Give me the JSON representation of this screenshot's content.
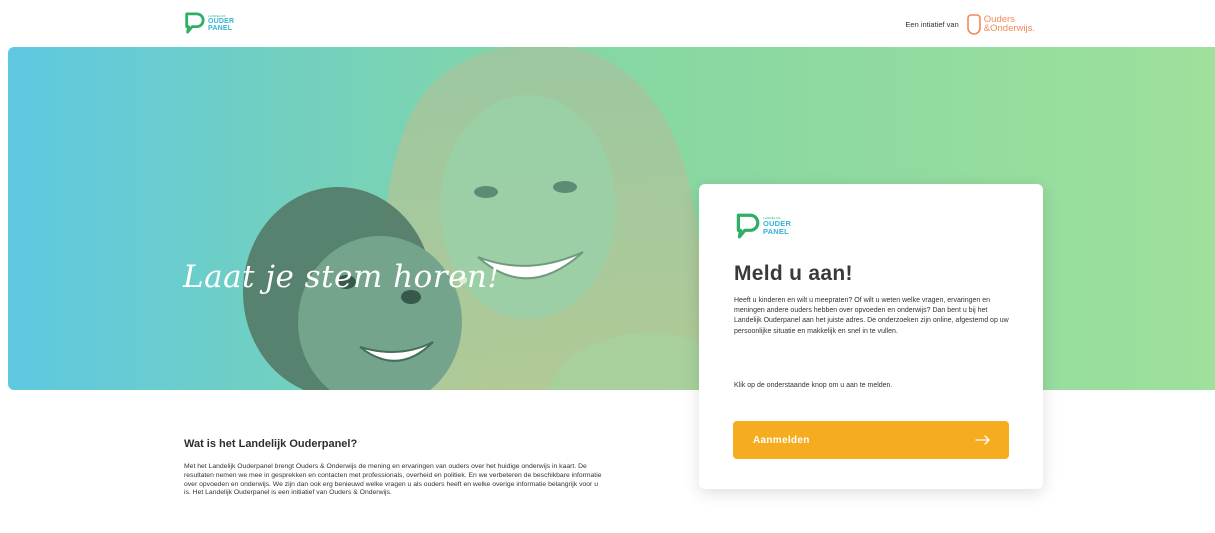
{
  "header": {
    "logo": {
      "small": "LANDELIJK",
      "line1": "OUDER",
      "line2": "PANEL"
    },
    "initiative_label": "Een intiatief van",
    "partner": {
      "line1": "Ouders",
      "line2": "&Onderwijs."
    }
  },
  "hero": {
    "tagline": "Laat je stem horen!"
  },
  "signup": {
    "logo": {
      "small": "LANDELIJK",
      "line1": "OUDER",
      "line2": "PANEL"
    },
    "title": "Meld u aan!",
    "text": "Heeft u kinderen en wilt u meepraten? Of wilt u weten welke vragen, ervaringen en meningen andere ouders hebben over opvoeden en onderwijs? Dan bent u bij het Landelijk Ouderpanel aan het juiste adres. De onderzoeken zijn online, afgestemd op uw persoonlijke situatie en makkelijk en snel in te vullen.",
    "cta_text": "Klik op de onderstaande knop om u aan te melden.",
    "button_label": "Aanmelden",
    "button_icon": "arrow-right-icon"
  },
  "info": {
    "title": "Wat is het Landelijk Ouderpanel?",
    "text": "Met het Landelijk Ouderpanel brengt Ouders & Onderwijs de mening en ervaringen van ouders over het huidige onderwijs in kaart. De resultaten nemen we mee in gesprekken en contacten met professionals, overheid en politiek. En we verbeteren de beschikbare informatie over opvoeden en onderwijs. We zijn dan ook erg benieuwd welke vragen u als ouders heeft en welke overige informatie belangrijk voor u is. Het Landelijk Ouderpanel is een initiatief van Ouders & Onderwijs."
  },
  "colors": {
    "brand_green": "#2fae66",
    "brand_blue": "#33b5d3",
    "partner_orange": "#f08a5b",
    "cta_orange": "#f6ac1f"
  }
}
